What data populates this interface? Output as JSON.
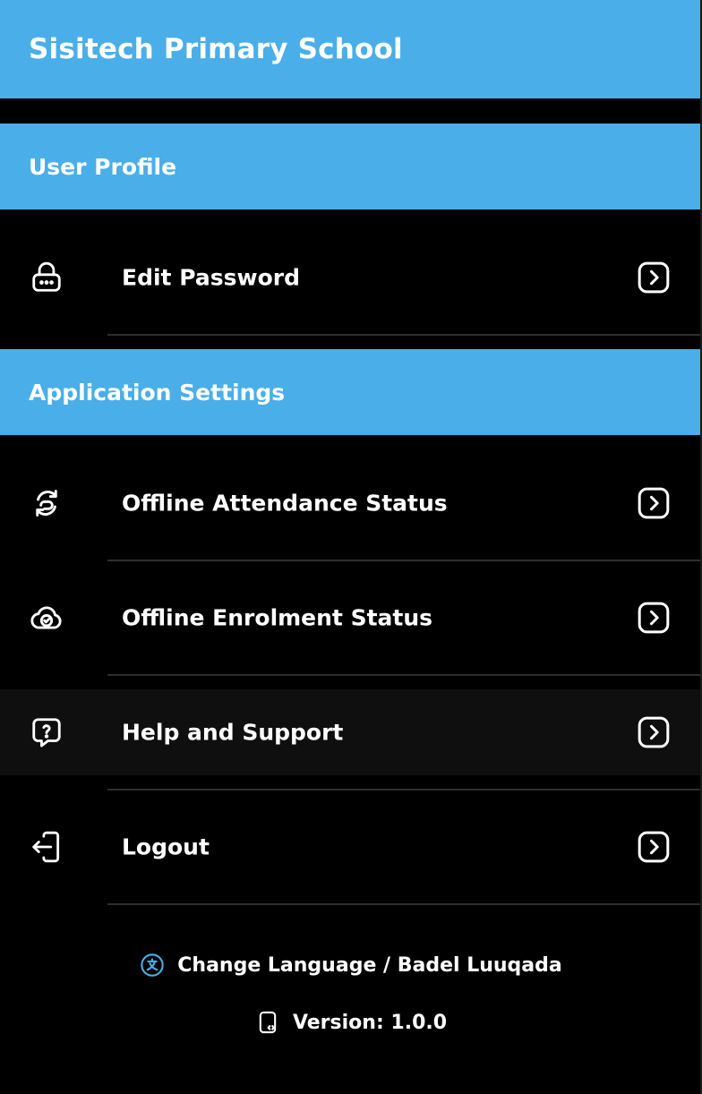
{
  "header": {
    "title": "Sisitech Primary School"
  },
  "sections": {
    "user_profile": {
      "title": "User Profile",
      "items": [
        {
          "label": "Edit Password",
          "icon": "lock-icon"
        }
      ]
    },
    "application_settings": {
      "title": "Application Settings",
      "items": [
        {
          "label": "Offline Attendance Status",
          "icon": "sync-icon"
        },
        {
          "label": "Offline Enrolment Status",
          "icon": "cloud-check-icon"
        },
        {
          "label": "Help and Support",
          "icon": "help-chat-icon"
        },
        {
          "label": "Logout",
          "icon": "logout-icon"
        }
      ]
    }
  },
  "footer": {
    "language": "Change Language / Badel Luuqada",
    "version": "Version: 1.0.0"
  },
  "colors": {
    "header_bg": "#4aaee8",
    "background": "#000000",
    "highlight_row": "#0f0f0f",
    "accent_icon": "#4aaee8"
  }
}
